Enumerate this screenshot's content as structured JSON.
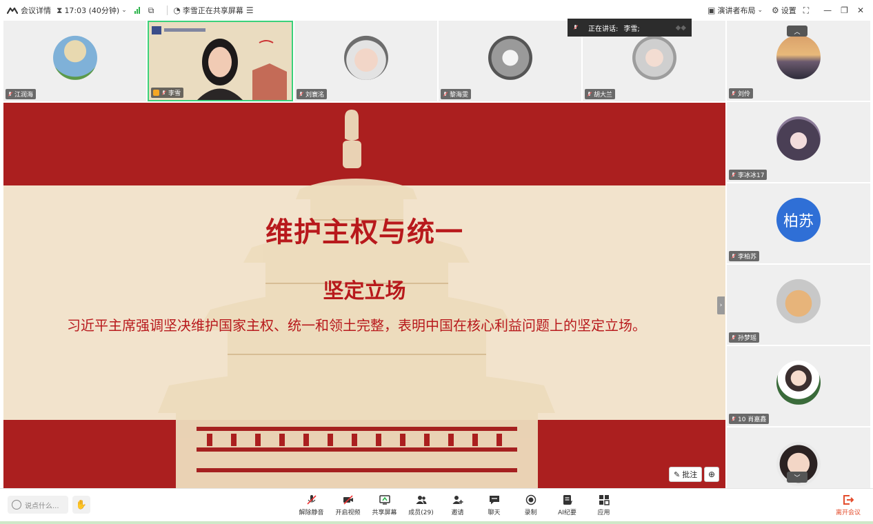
{
  "topbar": {
    "meeting_details": "会议详情",
    "time": "17:03 (40分钟)",
    "sharing_status": "李雪正在共享屏幕",
    "layout_label": "演讲者布局",
    "settings_label": "设置"
  },
  "speaking": {
    "label": "正在讲话:",
    "name": "李雪;"
  },
  "participants_top": [
    {
      "name": "江润海"
    },
    {
      "name": "李雪"
    },
    {
      "name": "刘寰洺"
    },
    {
      "name": "黎海雯"
    },
    {
      "name": "胡大兰"
    }
  ],
  "participants_right": [
    {
      "name": "刘伶"
    },
    {
      "name": "李冰冰17"
    },
    {
      "name": "李柏苏",
      "initials": "柏苏"
    },
    {
      "name": "孙梦瑶"
    },
    {
      "name": "10 肖嘉鑫"
    },
    {
      "name": ""
    }
  ],
  "slide": {
    "title": "维护主权与统一",
    "subtitle": "坚定立场",
    "body": "习近平主席强调坚决维护国家主权、统一和领土完整，表明中国在核心利益问题上的坚定立场。",
    "annotate_label": "批注"
  },
  "toolbar": {
    "chat_placeholder": "说点什么...",
    "unmute": "解除静音",
    "start_video": "开启视频",
    "share_screen": "共享屏幕",
    "members": "成员(29)",
    "invite": "邀请",
    "chat": "聊天",
    "record": "录制",
    "ai_minutes": "AI纪要",
    "apps": "应用",
    "leave": "离开会议"
  },
  "colors": {
    "slide_red": "#ab1f1f",
    "slide_cream": "#f2e3cc",
    "title_red": "#b8191c",
    "active_border": "#3ad17a",
    "leave_red": "#e44c2c",
    "initials_blue": "#2f6fd6"
  }
}
